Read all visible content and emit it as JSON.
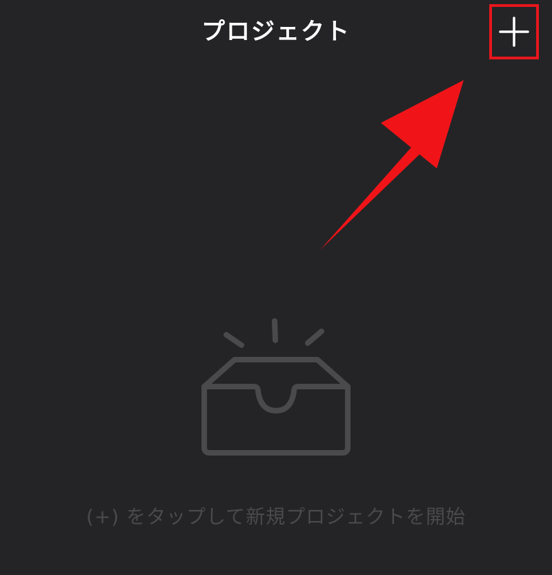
{
  "header": {
    "title": "プロジェクト",
    "add_button_label": "+"
  },
  "empty_state": {
    "icon": "open-inbox-tray-icon",
    "message": "(+) をタップして新規プロジェクトを開始"
  },
  "annotation": {
    "highlight_color": "#e8161d",
    "arrow_color": "#f01418"
  },
  "colors": {
    "background": "#242426",
    "title_text": "#ffffff",
    "empty_icon": "#4a4a4d",
    "empty_text": "#4a4a4d"
  }
}
